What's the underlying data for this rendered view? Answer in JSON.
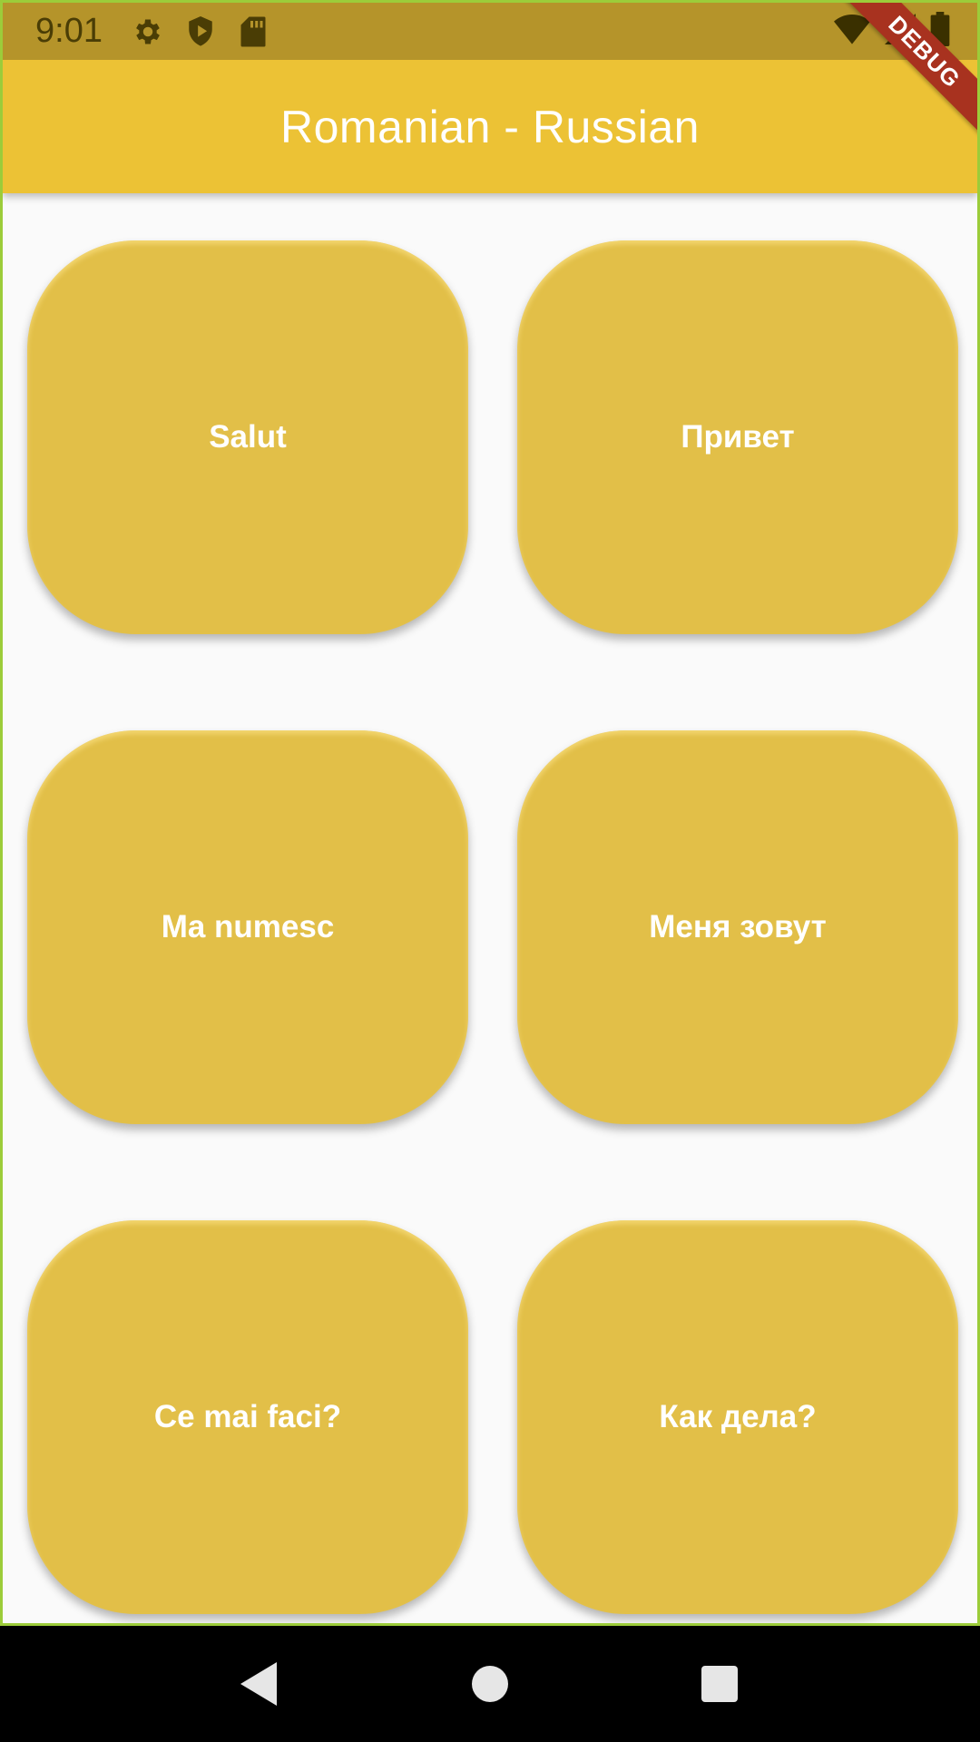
{
  "status_bar": {
    "time": "9:01",
    "icons": [
      "gear-icon",
      "shield-play-icon",
      "sd-card-icon",
      "wifi-icon",
      "signal-icon",
      "battery-icon"
    ]
  },
  "app_bar": {
    "title": "Romanian - Russian",
    "color": "#ecc235"
  },
  "debug_banner": {
    "label": "DEBUG"
  },
  "cards": [
    {
      "label": "Salut"
    },
    {
      "label": "Привет"
    },
    {
      "label": "Ma numesc"
    },
    {
      "label": "Меня зовут"
    },
    {
      "label": "Ce mai faci?"
    },
    {
      "label": "Как дела?"
    }
  ],
  "colors": {
    "card": "#e2bf48",
    "status_bar": "#b5942a",
    "background": "#fafafa",
    "debug_ribbon": "#a8321f"
  },
  "nav_bar": {
    "buttons": [
      "back-icon",
      "home-icon",
      "recents-icon"
    ]
  }
}
